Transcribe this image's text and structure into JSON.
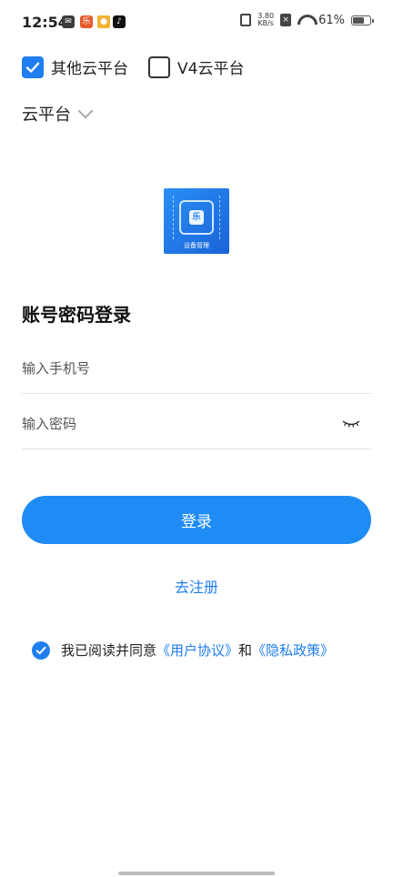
{
  "status_bar": {
    "time": "12:54",
    "notif_icons": [
      "mail-icon",
      "app-icon",
      "app-icon",
      "tiktok-icon"
    ],
    "net_speed_value": "3.80",
    "net_speed_unit": "KB/s",
    "battery_percent": "61%",
    "battery_level": 0.61
  },
  "platform_options": [
    {
      "label": "其他云平台",
      "checked": true
    },
    {
      "label": "V4云平台",
      "checked": false
    }
  ],
  "platform_selector": {
    "label": "云平台"
  },
  "logo": {
    "caption": "设备管理",
    "glyph": "乐"
  },
  "login": {
    "title": "账号密码登录",
    "phone_placeholder": "输入手机号",
    "password_placeholder": "输入密码",
    "button_label": "登录",
    "register_label": "去注册"
  },
  "agreement": {
    "prefix": "我已阅读并同意",
    "user_agreement": "《用户协议》",
    "connector": "和",
    "privacy_policy": "《隐私政策》",
    "checked": true
  },
  "colors": {
    "accent": "#1f7ef0",
    "button": "#1f8cf5"
  }
}
